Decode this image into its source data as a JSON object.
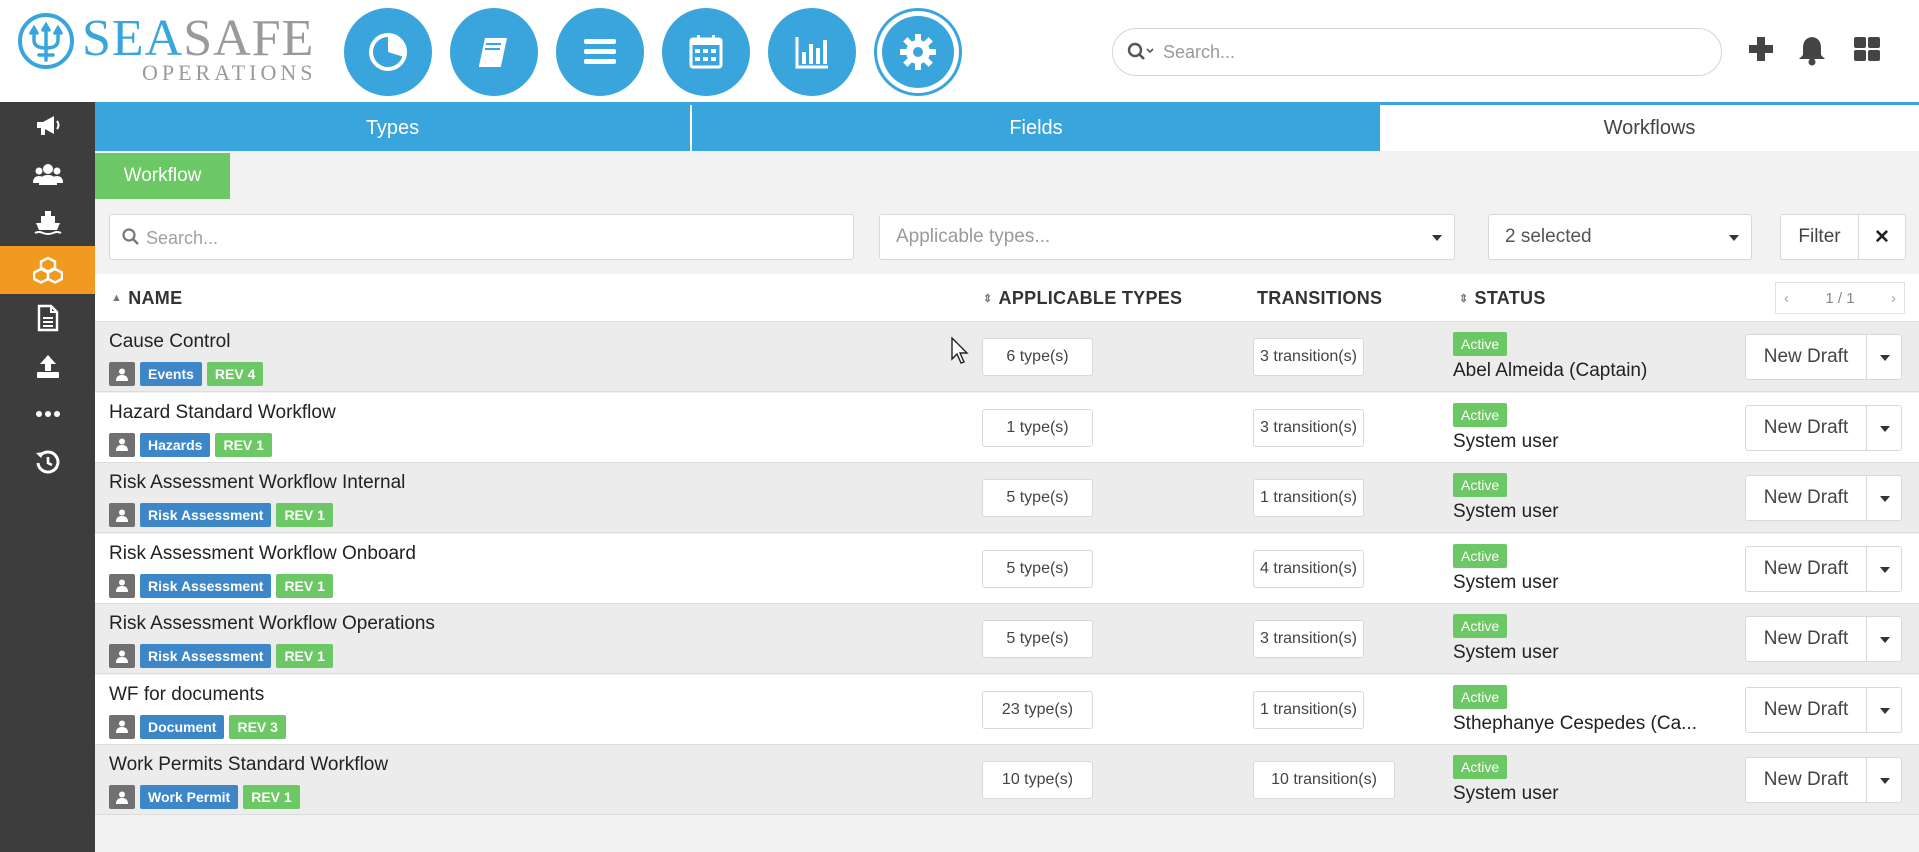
{
  "brand": {
    "word_sea": "SEA",
    "word_safe": "SAFE",
    "subtitle": "OPERATIONS",
    "accent": "#3aa5dc"
  },
  "top_nav": [
    {
      "icon": "pie-chart-icon"
    },
    {
      "icon": "book-icon"
    },
    {
      "icon": "list-icon"
    },
    {
      "icon": "calendar-icon"
    },
    {
      "icon": "bar-chart-icon"
    },
    {
      "icon": "gear-icon",
      "active": true
    }
  ],
  "header": {
    "search_placeholder": "Search...",
    "icons": [
      "plus-icon",
      "bell-icon",
      "grid-icon"
    ]
  },
  "sidebar": [
    {
      "icon": "megaphone-icon"
    },
    {
      "icon": "users-icon"
    },
    {
      "icon": "ship-icon"
    },
    {
      "icon": "cubes-icon",
      "active": true
    },
    {
      "icon": "document-icon"
    },
    {
      "icon": "upload-icon"
    },
    {
      "icon": "more-icon"
    },
    {
      "icon": "history-icon"
    }
  ],
  "tabs": {
    "types": "Types",
    "fields": "Fields",
    "workflows": "Workflows"
  },
  "subtab": "Workflow",
  "filters": {
    "search_placeholder": "Search...",
    "applicable_types_placeholder": "Applicable types...",
    "status_value": "2 selected",
    "filter_label": "Filter",
    "clear_label": "✕"
  },
  "table": {
    "columns": {
      "name": "NAME",
      "applicable_types": "APPLICABLE TYPES",
      "transitions": "TRANSITIONS",
      "status": "STATUS"
    },
    "pager": {
      "prev": "‹",
      "page": "1 / 1",
      "next": "›"
    },
    "rows": [
      {
        "name": "Cause Control",
        "category": "Events",
        "rev": "REV 4",
        "types": "6 type(s)",
        "transitions": "3 transition(s)",
        "status": "Active",
        "user": "Abel Almeida (Captain)",
        "action": "New Draft"
      },
      {
        "name": "Hazard Standard Workflow",
        "category": "Hazards",
        "rev": "REV 1",
        "types": "1 type(s)",
        "transitions": "3 transition(s)",
        "status": "Active",
        "user": "System user",
        "action": "New Draft"
      },
      {
        "name": "Risk Assessment Workflow Internal",
        "category": "Risk Assessment",
        "rev": "REV 1",
        "types": "5 type(s)",
        "transitions": "1 transition(s)",
        "status": "Active",
        "user": "System user",
        "action": "New Draft"
      },
      {
        "name": "Risk Assessment Workflow Onboard",
        "category": "Risk Assessment",
        "rev": "REV 1",
        "types": "5 type(s)",
        "transitions": "4 transition(s)",
        "status": "Active",
        "user": "System user",
        "action": "New Draft"
      },
      {
        "name": "Risk Assessment Workflow Operations",
        "category": "Risk Assessment",
        "rev": "REV 1",
        "types": "5 type(s)",
        "transitions": "3 transition(s)",
        "status": "Active",
        "user": "System user",
        "action": "New Draft"
      },
      {
        "name": "WF for documents",
        "category": "Document",
        "rev": "REV 3",
        "types": "23 type(s)",
        "transitions": "1 transition(s)",
        "status": "Active",
        "user": "Sthephanye Cespedes (Ca...",
        "action": "New Draft"
      },
      {
        "name": "Work Permits Standard Workflow",
        "category": "Work Permit",
        "rev": "REV 1",
        "types": "10 type(s)",
        "transitions": "10 transition(s)",
        "status": "Active",
        "user": "System user",
        "action": "New Draft"
      }
    ]
  }
}
